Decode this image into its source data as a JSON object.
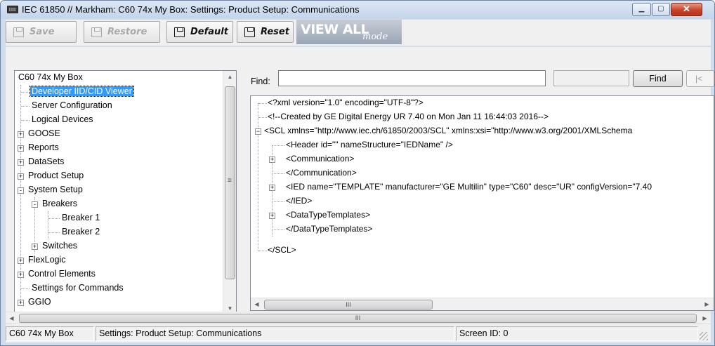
{
  "window": {
    "title": "IEC 61850 // Markham: C60 74x My Box: Settings: Product Setup: Communications"
  },
  "toolbar": {
    "save_label": "Save",
    "restore_label": "Restore",
    "default_label": "Default",
    "reset_label": "Reset",
    "view_all_label": "VIEW ALL",
    "mode_label": "mode"
  },
  "tree": {
    "root": "C60 74x My Box",
    "items": [
      {
        "label": "Developer IID/CID Viewer",
        "selected": true
      },
      {
        "label": "Server Configuration"
      },
      {
        "label": "Logical Devices"
      },
      {
        "label": "GOOSE",
        "expander": "+"
      },
      {
        "label": "Reports",
        "expander": "+"
      },
      {
        "label": "DataSets",
        "expander": "+"
      },
      {
        "label": "Product Setup",
        "expander": "+"
      },
      {
        "label": "System Setup",
        "expander": "-"
      },
      {
        "label": "Breakers",
        "expander": "-"
      },
      {
        "label": "Breaker 1"
      },
      {
        "label": "Breaker 2"
      },
      {
        "label": "Switches",
        "expander": "+"
      },
      {
        "label": "FlexLogic",
        "expander": "+"
      },
      {
        "label": "Control Elements",
        "expander": "+"
      },
      {
        "label": "Settings for Commands"
      },
      {
        "label": "GGIO",
        "expander": "+"
      }
    ]
  },
  "find": {
    "label": "Find:",
    "value": "",
    "button_label": "Find",
    "prev_label": "|<"
  },
  "xml": {
    "lines": [
      "<?xml version=\"1.0\" encoding=\"UTF-8\"?>",
      "<!--Created by GE Digital Energy UR 7.40 on Mon Jan 11 16:44:03 2016-->",
      "<SCL  xmlns=\"http://www.iec.ch/61850/2003/SCL\" xmlns:xsi=\"http://www.w3.org/2001/XMLSchema",
      "<Header id=\"\" nameStructure=\"IEDName\" />",
      "<Communication>",
      "</Communication>",
      "<IED name=\"TEMPLATE\" manufacturer=\"GE Multilin\" type=\"C60\" desc=\"UR\" configVersion=\"7.40",
      "</IED>",
      "<DataTypeTemplates>",
      "</DataTypeTemplates>",
      "</SCL>"
    ],
    "scroll_thumb_label": "III"
  },
  "tree_hscroll_label": "III",
  "statusbar": {
    "device": "C60 74x My Box",
    "path": "Settings: Product Setup: Communications",
    "screen_id": "Screen ID: 0"
  },
  "colors": {
    "selection": "#3399ff",
    "title_bar": "#cfdcec",
    "close_button": "#c8432a"
  }
}
